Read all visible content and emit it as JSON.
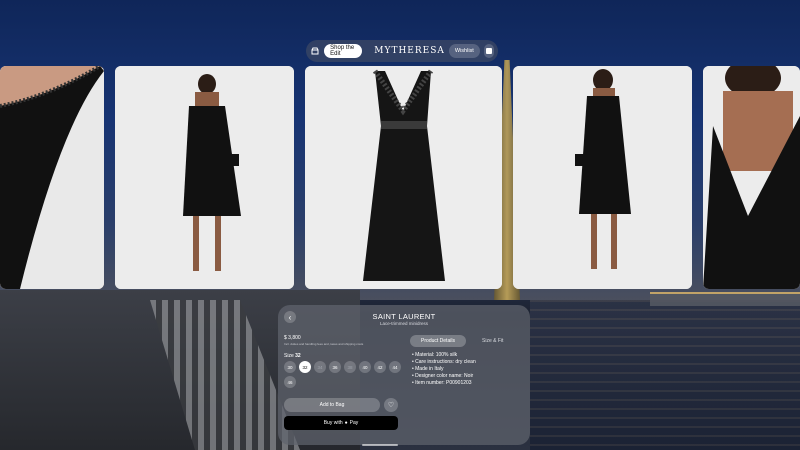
{
  "nav": {
    "shop_label": "Shop the Edit",
    "brand": "MYTHERESA",
    "wishlist_label": "Wishlist"
  },
  "product": {
    "brand": "SAINT LAURENT",
    "name": "Lace-trimmed minidress",
    "price": "$ 3,800",
    "price_note": "Incl. duties and handling fees and, taxes and shipping costs",
    "size_label": "Size",
    "selected_size": "32",
    "sizes": [
      "30",
      "32",
      "34",
      "36",
      "38",
      "40",
      "42",
      "44",
      "46"
    ],
    "add_to_bag": "Add to Bag",
    "buy_with": "Buy with",
    "pay": "Pay",
    "tabs": [
      "Product Details",
      "Size & Fit"
    ],
    "details": [
      "Material: 100% silk",
      "Care instructions: dry clean",
      "Made in Italy",
      "Designer color name: Noir",
      "Item number: P00901203"
    ]
  },
  "icons": {
    "store": "store-icon",
    "bag": "bag-icon",
    "back": "chevron-left-icon",
    "wishlist": "heart-icon",
    "apple": "apple-icon"
  }
}
